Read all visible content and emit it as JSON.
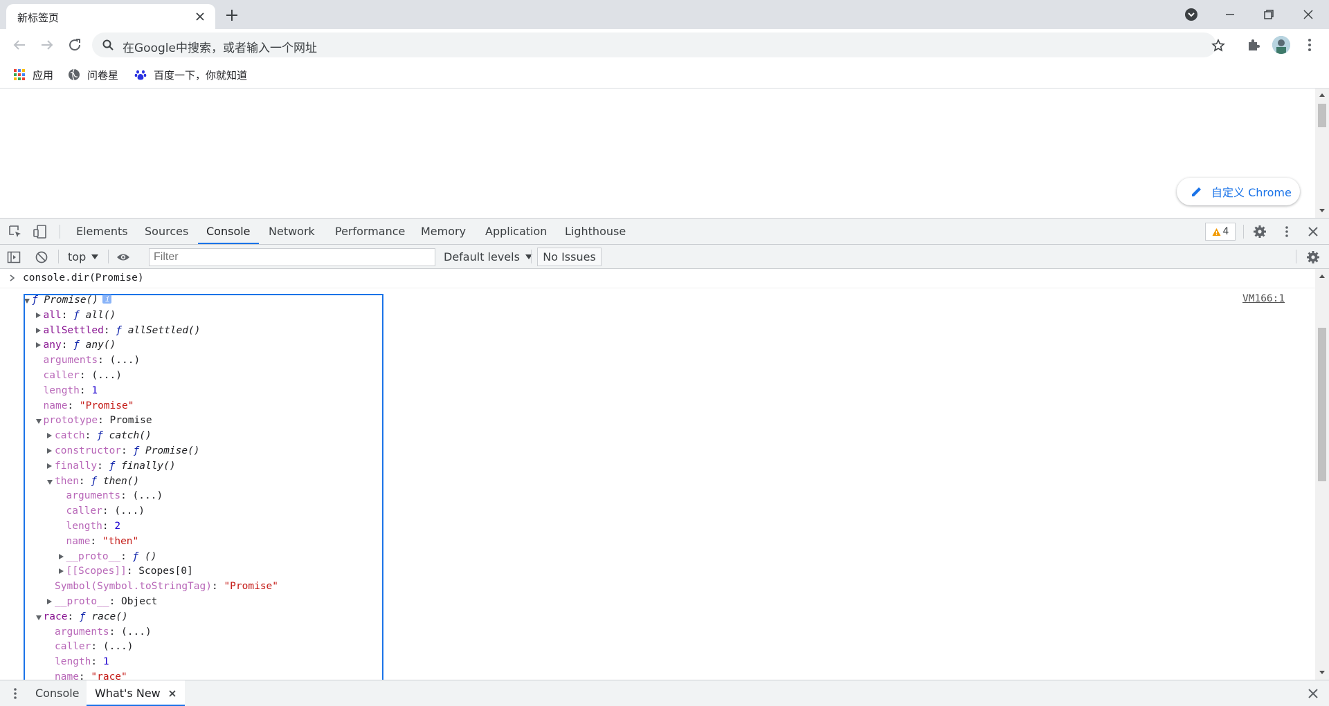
{
  "browser": {
    "tab_title": "新标签页",
    "omnibox_placeholder": "在Google中搜索，或者输入一个网址",
    "bookmarks": [
      {
        "label": "应用",
        "icon": "apps-grid-icon"
      },
      {
        "label": "问卷星",
        "icon": "globe-icon"
      },
      {
        "label": "百度一下，你就知道",
        "icon": "baidu-paw-icon"
      }
    ],
    "customize_label": "自定义 Chrome"
  },
  "devtools": {
    "tabs": [
      "Elements",
      "Sources",
      "Console",
      "Network",
      "Performance",
      "Memory",
      "Application",
      "Lighthouse"
    ],
    "active_tab": "Console",
    "warning_count": "4",
    "context": "top",
    "filter_placeholder": "Filter",
    "levels_label": "Default levels",
    "issues_label": "No Issues",
    "command": "console.dir(Promise)",
    "source_link": "VM166:1",
    "drawer_tabs": [
      "Console",
      "What's New"
    ],
    "active_drawer_tab": "What's New"
  },
  "console_tree": [
    {
      "depth": 0,
      "tw": "open",
      "parts": [
        [
          "f",
          "ƒ "
        ],
        [
          "fn",
          "Promise()"
        ]
      ],
      "info": true
    },
    {
      "depth": 1,
      "tw": "closed",
      "parts": [
        [
          "k",
          "all"
        ],
        [
          "p",
          ": "
        ],
        [
          "f",
          "ƒ "
        ],
        [
          "fn",
          "all()"
        ]
      ]
    },
    {
      "depth": 1,
      "tw": "closed",
      "parts": [
        [
          "k",
          "allSettled"
        ],
        [
          "p",
          ": "
        ],
        [
          "f",
          "ƒ "
        ],
        [
          "fn",
          "allSettled()"
        ]
      ]
    },
    {
      "depth": 1,
      "tw": "closed",
      "parts": [
        [
          "k",
          "any"
        ],
        [
          "p",
          ": "
        ],
        [
          "f",
          "ƒ "
        ],
        [
          "fn",
          "any()"
        ]
      ]
    },
    {
      "depth": 1,
      "tw": "",
      "parts": [
        [
          "k dim",
          "arguments"
        ],
        [
          "p",
          ": (...)"
        ]
      ]
    },
    {
      "depth": 1,
      "tw": "",
      "parts": [
        [
          "k dim",
          "caller"
        ],
        [
          "p",
          ": (...)"
        ]
      ]
    },
    {
      "depth": 1,
      "tw": "",
      "parts": [
        [
          "k dim",
          "length"
        ],
        [
          "p",
          ": "
        ],
        [
          "num",
          "1"
        ]
      ]
    },
    {
      "depth": 1,
      "tw": "",
      "parts": [
        [
          "k dim",
          "name"
        ],
        [
          "p",
          ": "
        ],
        [
          "str",
          "\"Promise\""
        ]
      ]
    },
    {
      "depth": 1,
      "tw": "open",
      "parts": [
        [
          "k dim",
          "prototype"
        ],
        [
          "p",
          ": Promise"
        ]
      ]
    },
    {
      "depth": 2,
      "tw": "closed",
      "parts": [
        [
          "k dim",
          "catch"
        ],
        [
          "p",
          ": "
        ],
        [
          "f",
          "ƒ "
        ],
        [
          "fn",
          "catch()"
        ]
      ]
    },
    {
      "depth": 2,
      "tw": "closed",
      "parts": [
        [
          "k dim",
          "constructor"
        ],
        [
          "p",
          ": "
        ],
        [
          "f",
          "ƒ "
        ],
        [
          "fn",
          "Promise()"
        ]
      ]
    },
    {
      "depth": 2,
      "tw": "closed",
      "parts": [
        [
          "k dim",
          "finally"
        ],
        [
          "p",
          ": "
        ],
        [
          "f",
          "ƒ "
        ],
        [
          "fn",
          "finally()"
        ]
      ]
    },
    {
      "depth": 2,
      "tw": "open",
      "parts": [
        [
          "k dim",
          "then"
        ],
        [
          "p",
          ": "
        ],
        [
          "f",
          "ƒ "
        ],
        [
          "fn",
          "then()"
        ]
      ]
    },
    {
      "depth": 3,
      "tw": "",
      "parts": [
        [
          "k dim",
          "arguments"
        ],
        [
          "p",
          ": (...)"
        ]
      ]
    },
    {
      "depth": 3,
      "tw": "",
      "parts": [
        [
          "k dim",
          "caller"
        ],
        [
          "p",
          ": (...)"
        ]
      ]
    },
    {
      "depth": 3,
      "tw": "",
      "parts": [
        [
          "k dim",
          "length"
        ],
        [
          "p",
          ": "
        ],
        [
          "num",
          "2"
        ]
      ]
    },
    {
      "depth": 3,
      "tw": "",
      "parts": [
        [
          "k dim",
          "name"
        ],
        [
          "p",
          ": "
        ],
        [
          "str",
          "\"then\""
        ]
      ]
    },
    {
      "depth": 3,
      "tw": "closed",
      "parts": [
        [
          "k dim",
          "__proto__"
        ],
        [
          "p",
          ": "
        ],
        [
          "f",
          "ƒ "
        ],
        [
          "fn",
          "()"
        ]
      ]
    },
    {
      "depth": 3,
      "tw": "closed",
      "parts": [
        [
          "k dim",
          "[[Scopes]]"
        ],
        [
          "p",
          ": Scopes[0]"
        ]
      ]
    },
    {
      "depth": 2,
      "tw": "",
      "parts": [
        [
          "k dim",
          "Symbol(Symbol.toStringTag)"
        ],
        [
          "p",
          ": "
        ],
        [
          "str",
          "\"Promise\""
        ]
      ]
    },
    {
      "depth": 2,
      "tw": "closed",
      "parts": [
        [
          "k dim",
          "__proto__"
        ],
        [
          "p",
          ": Object"
        ]
      ]
    },
    {
      "depth": 1,
      "tw": "open",
      "parts": [
        [
          "k",
          "race"
        ],
        [
          "p",
          ": "
        ],
        [
          "f",
          "ƒ "
        ],
        [
          "fn",
          "race()"
        ]
      ]
    },
    {
      "depth": 2,
      "tw": "",
      "parts": [
        [
          "k dim",
          "arguments"
        ],
        [
          "p",
          ": (...)"
        ]
      ]
    },
    {
      "depth": 2,
      "tw": "",
      "parts": [
        [
          "k dim",
          "caller"
        ],
        [
          "p",
          ": (...)"
        ]
      ]
    },
    {
      "depth": 2,
      "tw": "",
      "parts": [
        [
          "k dim",
          "length"
        ],
        [
          "p",
          ": "
        ],
        [
          "num",
          "1"
        ]
      ]
    },
    {
      "depth": 2,
      "tw": "",
      "parts": [
        [
          "k dim",
          "name"
        ],
        [
          "p",
          ": "
        ],
        [
          "str",
          "\"race\""
        ]
      ]
    }
  ],
  "colors": {
    "accent": "#1a73e8",
    "tab_strip": "#dee1e6",
    "devtools_bar": "#f1f3f4"
  }
}
